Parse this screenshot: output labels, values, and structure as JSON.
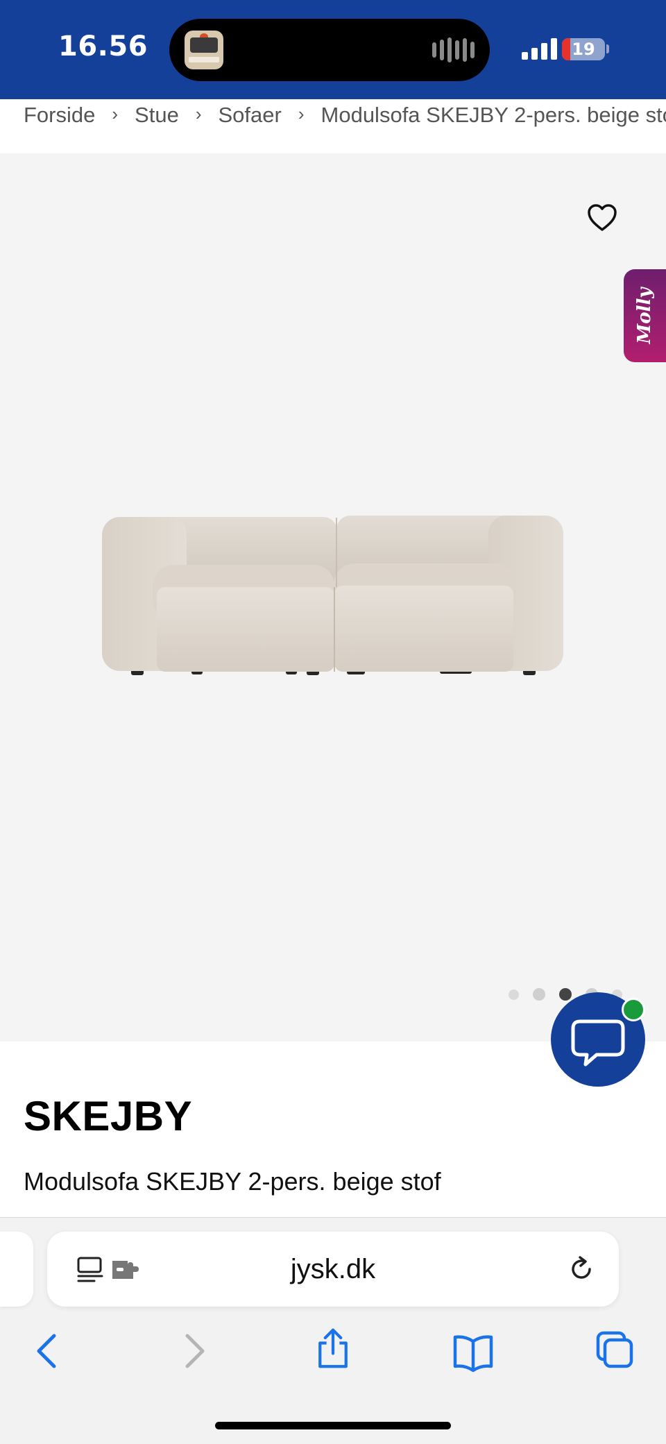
{
  "status_bar": {
    "time": "16.56",
    "battery_level": "19",
    "battery_fraction": 0.19,
    "island_activity_icon": "album-art-icon",
    "island_waveform_icon": "audio-waveform-icon",
    "cellular_icon": "cellular-signal-icon",
    "accent_color": "#15409a"
  },
  "breadcrumb": {
    "items": [
      "Forside",
      "Stue",
      "Sofaer"
    ],
    "current": "Modulsofa SKEJBY 2-pers. beige stof",
    "separator_icon": "chevron-right-icon"
  },
  "gallery": {
    "wishlist_icon": "heart-icon",
    "assistant_tab_label": "Molly",
    "image_subject": "sofa-image",
    "image_count": 5,
    "active_image_index": 2
  },
  "chat": {
    "icon": "chat-bubble-icon",
    "online_indicator_color": "#1a9b3b"
  },
  "product": {
    "brand": "SKEJBY",
    "name": "Modulsofa SKEJBY 2-pers. beige stof"
  },
  "browser": {
    "url": "jysk.dk",
    "reader_icon": "reader-mode-icon",
    "extension_icon": "extension-icon",
    "reload_icon": "reload-icon",
    "toolbar": [
      "back-icon",
      "forward-icon",
      "share-icon",
      "bookmarks-icon",
      "tabs-icon"
    ]
  }
}
